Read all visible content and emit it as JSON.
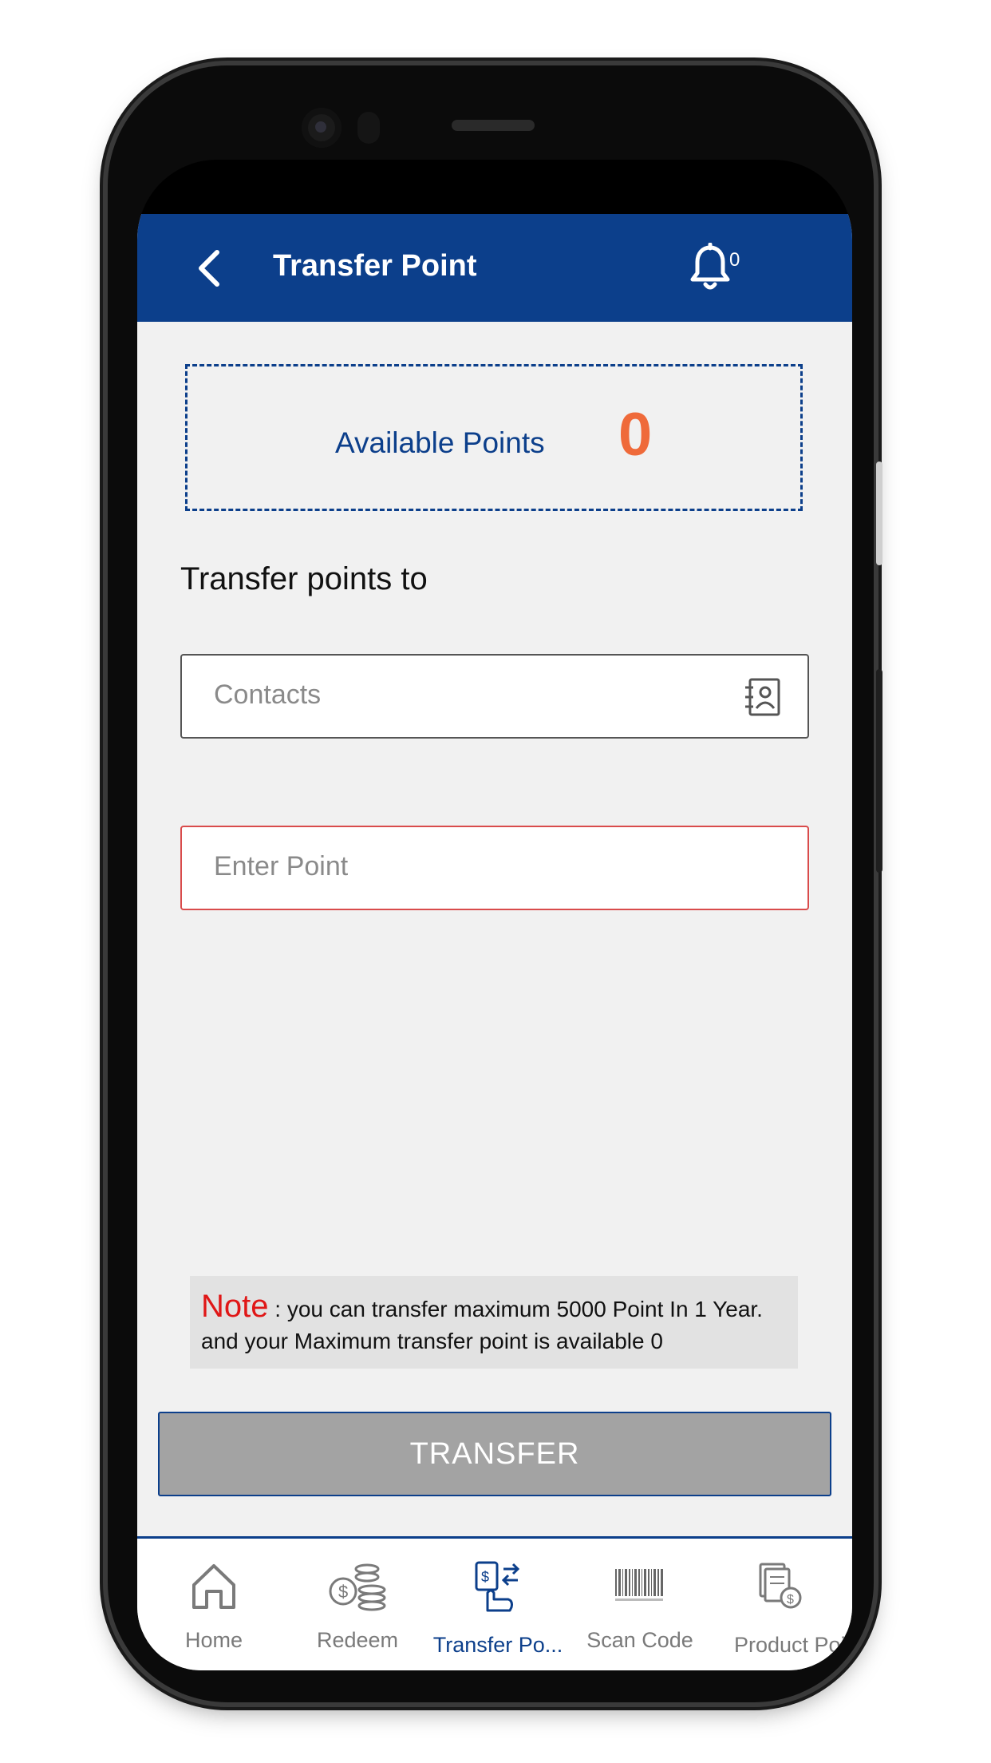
{
  "header": {
    "title": "Transfer Point",
    "notification_count": "0"
  },
  "available_points": {
    "label": "Available Points",
    "value": "0"
  },
  "form": {
    "section_label": "Transfer points to",
    "contacts_placeholder": "Contacts",
    "points_placeholder": "Enter Point"
  },
  "note": {
    "label": "Note",
    "text": ": you can transfer maximum 5000 Point In 1 Year. and your Maximum transfer point is available 0"
  },
  "transfer_button": "TRANSFER",
  "tabs": [
    {
      "label": "Home",
      "icon": "home-icon",
      "active": false
    },
    {
      "label": "Redeem",
      "icon": "coins-icon",
      "active": false
    },
    {
      "label": "Transfer Po...",
      "icon": "transfer-icon",
      "active": true
    },
    {
      "label": "Scan Code",
      "icon": "barcode-icon",
      "active": false
    },
    {
      "label": "Product Poi",
      "icon": "product-points-icon",
      "active": false
    }
  ],
  "colors": {
    "primary": "#0c3f8b",
    "accent": "#ef6a3a",
    "note_red": "#e01717",
    "button_gray": "#a3a3a3"
  }
}
